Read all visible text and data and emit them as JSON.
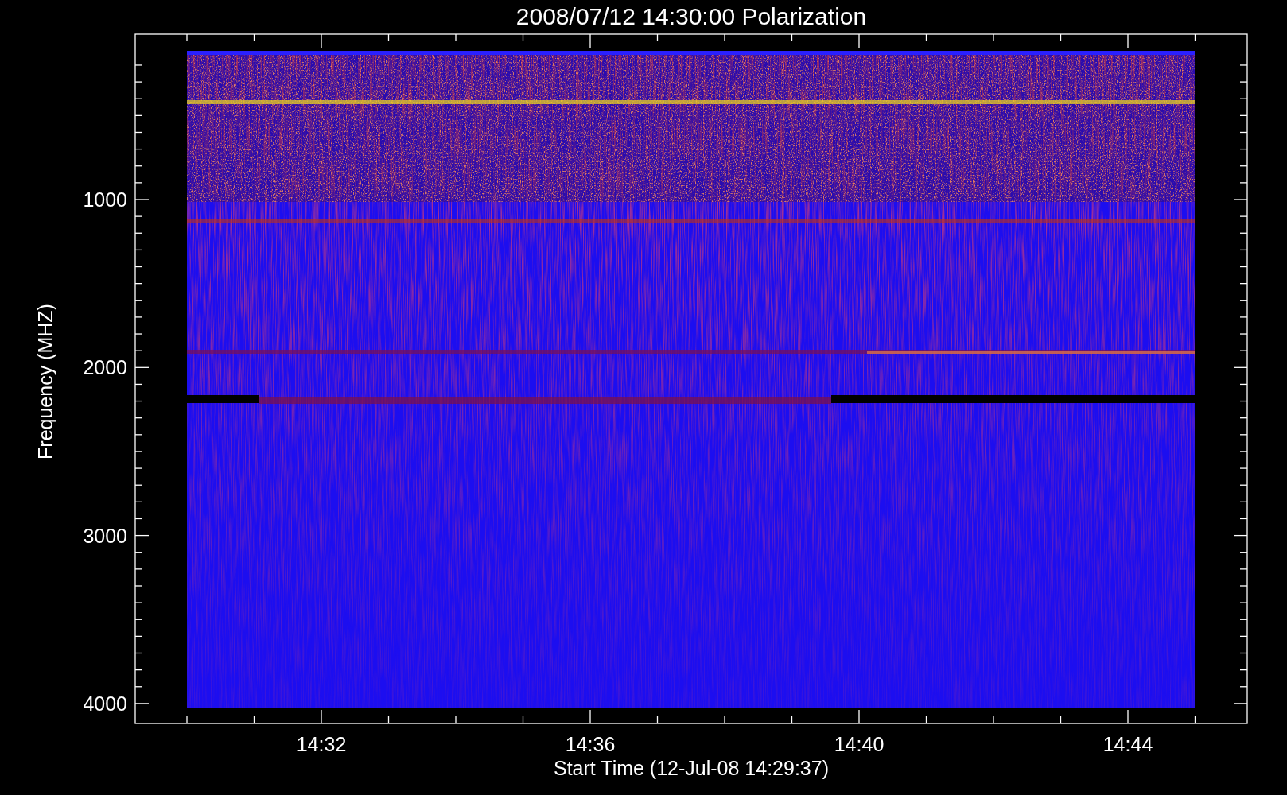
{
  "title": "2008/07/12 14:30:00 Polarization",
  "ylabel": "Frequency (MHZ)",
  "xlabel": "Start Time (12-Jul-08 14:29:37)",
  "yticks": [
    {
      "label": "1000"
    },
    {
      "label": "2000"
    },
    {
      "label": "3000"
    },
    {
      "label": "4000"
    }
  ],
  "xticks": [
    {
      "label": "14:32"
    },
    {
      "label": "14:36"
    },
    {
      "label": "14:40"
    },
    {
      "label": "14:44"
    }
  ]
}
